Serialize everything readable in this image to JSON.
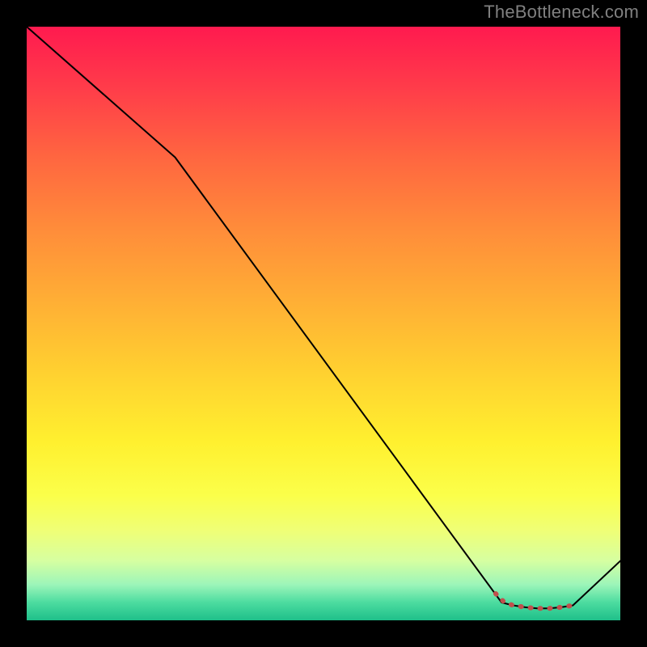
{
  "watermark": "TheBottleneck.com",
  "chart_data": {
    "type": "line",
    "title": "",
    "xlabel": "",
    "ylabel": "",
    "xlim": [
      0,
      100
    ],
    "ylim": [
      0,
      100
    ],
    "series": [
      {
        "name": "bottleneck-curve",
        "x": [
          0,
          25,
          80,
          82,
          84,
          86,
          88,
          90,
          92,
          100
        ],
        "values": [
          100,
          78,
          3,
          2.5,
          2.2,
          2.0,
          2.0,
          2.2,
          2.5,
          10
        ],
        "color": "#000000",
        "width": 2
      },
      {
        "name": "optimal-range-marker",
        "x": [
          79,
          80.5,
          82,
          84,
          86,
          88,
          90,
          92
        ],
        "values": [
          4.5,
          3.0,
          2.5,
          2.2,
          2.0,
          2.0,
          2.2,
          2.5
        ],
        "color": "#c0504d",
        "width": 6,
        "dash": true
      }
    ],
    "background": "vertical-gradient red→yellow→green"
  }
}
